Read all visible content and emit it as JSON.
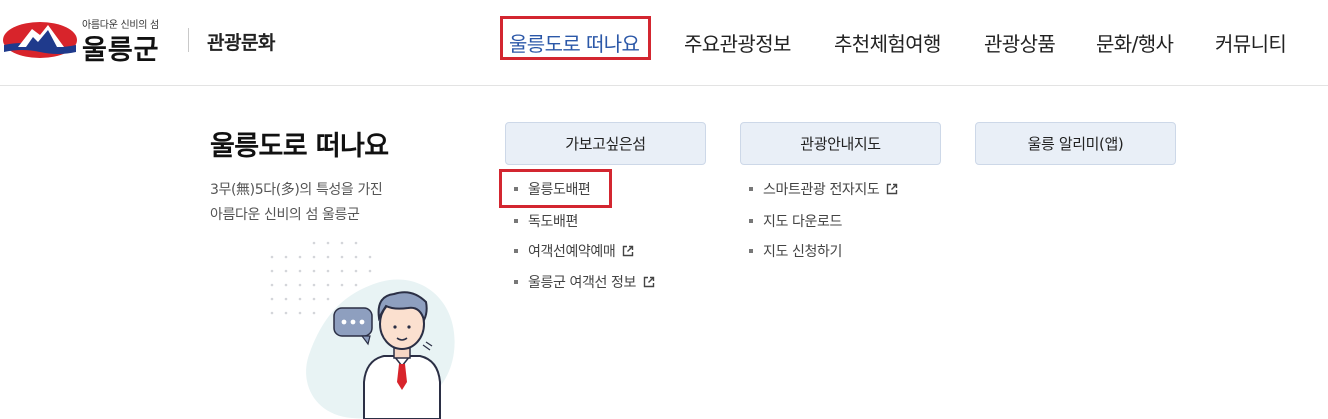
{
  "header": {
    "logo": {
      "tagline": "아름다운 신비의 섬",
      "name": "울릉군",
      "icon": "ulleung-mountain-emblem-icon",
      "colors": {
        "red": "#d8242b",
        "navy": "#1f3a8c"
      }
    },
    "section_title": "관광문화",
    "nav": [
      {
        "label": "울릉도로 떠나요",
        "active": true
      },
      {
        "label": "주요관광정보",
        "active": false
      },
      {
        "label": "추천체험여행",
        "active": false
      },
      {
        "label": "관광상품",
        "active": false
      },
      {
        "label": "문화/행사",
        "active": false
      },
      {
        "label": "커뮤니티",
        "active": false
      }
    ]
  },
  "mega_menu": {
    "title": "울릉도로 떠나요",
    "description_line1": "3무(無)5다(多)의 특성을 가진",
    "description_line2": "아름다운 신비의 섬 울릉군",
    "columns": [
      {
        "heading": "가보고싶은섬",
        "items": [
          {
            "label": "울릉도배편",
            "external": false
          },
          {
            "label": "독도배편",
            "external": false
          },
          {
            "label": "여객선예약예매",
            "external": true
          },
          {
            "label": "울릉군 여객선 정보",
            "external": true
          }
        ]
      },
      {
        "heading": "관광안내지도",
        "items": [
          {
            "label": "스마트관광 전자지도",
            "external": true
          },
          {
            "label": "지도 다운로드",
            "external": false
          },
          {
            "label": "지도 신청하기",
            "external": false
          }
        ]
      },
      {
        "heading": "울릉 알리미(앱)",
        "items": []
      }
    ]
  },
  "colors": {
    "accent_blue": "#2c58a8",
    "highlight_red": "#d32630",
    "button_bg": "#e9eff7"
  }
}
